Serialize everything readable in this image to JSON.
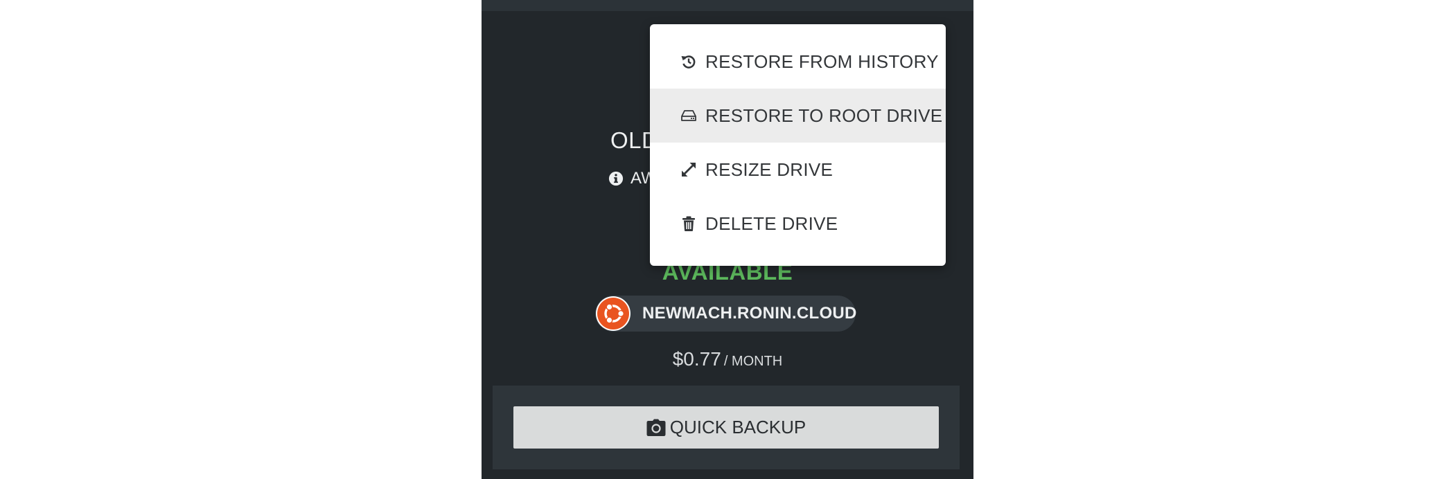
{
  "drive": {
    "title_visible": "OLD",
    "zone_visible": "AW",
    "status": "AVAILABLE",
    "machine": "NEWMACH.RONIN.CLOUD",
    "price": "$0.77",
    "price_unit": "/ MONTH"
  },
  "footer": {
    "quick_backup_label": "QUICK BACKUP"
  },
  "menu": {
    "items": [
      {
        "label": "RESTORE FROM HISTORY",
        "icon": "history-icon"
      },
      {
        "label": "RESTORE TO ROOT DRIVE",
        "icon": "hard-drive-icon"
      },
      {
        "label": "RESIZE DRIVE",
        "icon": "expand-arrows-icon"
      },
      {
        "label": "DELETE DRIVE",
        "icon": "trash-icon"
      }
    ],
    "highlighted_item": "RESTORE TO ROOT DRIVE"
  },
  "colors": {
    "panel_bg": "#22272b",
    "status_green": "#5cb85c",
    "ubuntu_orange": "#e95420",
    "menu_highlight": "#ececec"
  }
}
